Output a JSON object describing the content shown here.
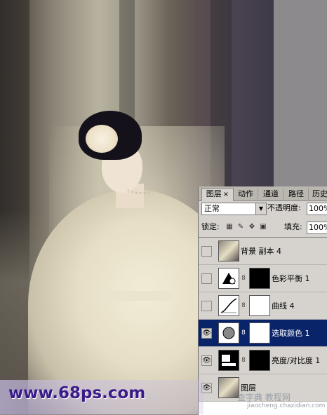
{
  "panel": {
    "tabs": [
      {
        "label": "图层",
        "close": "×"
      },
      {
        "label": "动作"
      },
      {
        "label": "通道"
      },
      {
        "label": "路径"
      },
      {
        "label": "历史"
      }
    ],
    "blend_mode": "正常",
    "opacity_label": "不透明度:",
    "opacity_value": "100%",
    "lock_label": "锁定:",
    "fill_label": "填充:",
    "fill_value": "100%"
  },
  "layers": [
    {
      "name": "背景 副本 4",
      "visible": false,
      "selected": false
    },
    {
      "name": "色彩平衡 1",
      "visible": false,
      "selected": false
    },
    {
      "name": "曲线 4",
      "visible": false,
      "selected": false
    },
    {
      "name": "选取颜色 1",
      "visible": true,
      "selected": true
    },
    {
      "name": "亮度/对比度 1",
      "visible": true,
      "selected": false
    },
    {
      "name": "图层",
      "visible": true,
      "selected": false
    }
  ],
  "icons": {
    "eye": "eye-icon",
    "chain": "link-icon",
    "dropdown": "chevron-down-icon"
  },
  "watermark": {
    "main": "www.68ps.com",
    "secondary": "查字典 教程网",
    "url": "jiaocheng.chazidian.com"
  },
  "colors": {
    "selection": "#0a246a",
    "panel_bg": "#d6d3ce",
    "watermark": "#3a1b8a"
  }
}
